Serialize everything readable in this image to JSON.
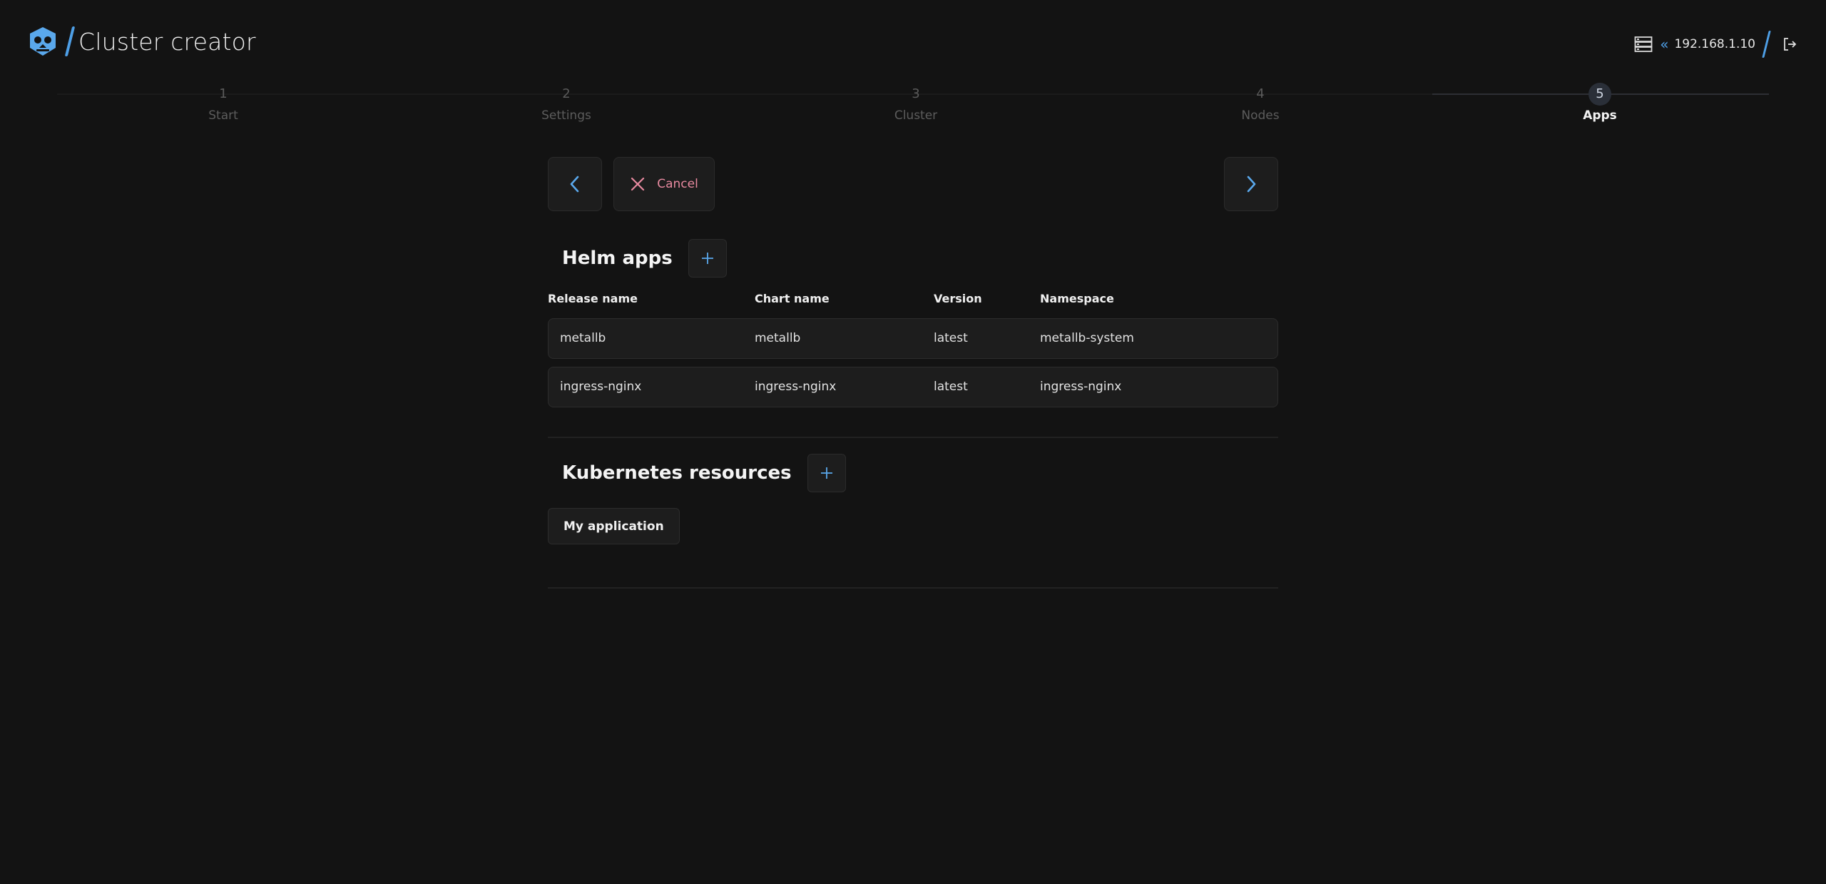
{
  "header": {
    "title": "Cluster creator",
    "server_ip": "192.168.1.10",
    "server_icon": "server-icon",
    "logout_icon": "logout-icon"
  },
  "stepper": {
    "steps": [
      {
        "number": "1",
        "label": "Start"
      },
      {
        "number": "2",
        "label": "Settings"
      },
      {
        "number": "3",
        "label": "Cluster"
      },
      {
        "number": "4",
        "label": "Nodes"
      },
      {
        "number": "5",
        "label": "Apps"
      }
    ],
    "active_step": 5
  },
  "nav": {
    "cancel_label": "Cancel"
  },
  "helm": {
    "title": "Helm apps",
    "columns": [
      "Release name",
      "Chart name",
      "Version",
      "Namespace"
    ],
    "rows": [
      {
        "release": "metallb",
        "chart": "metallb",
        "version": "latest",
        "namespace": "metallb-system"
      },
      {
        "release": "ingress-nginx",
        "chart": "ingress-nginx",
        "version": "latest",
        "namespace": "ingress-nginx"
      }
    ]
  },
  "kubernetes": {
    "title": "Kubernetes resources",
    "resources": [
      "My application"
    ]
  },
  "colors": {
    "background": "#131313",
    "accent": "#4e9fe6",
    "cancel": "#e88aa0",
    "surface": "#1d1d1d"
  }
}
